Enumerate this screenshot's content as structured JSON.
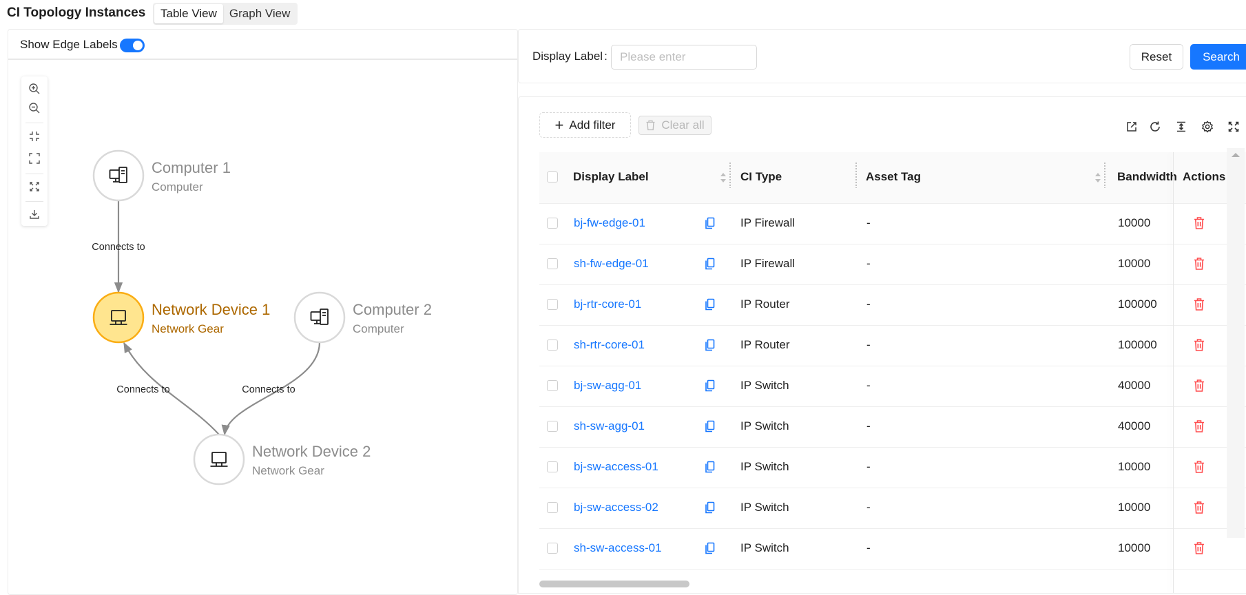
{
  "header": {
    "title": "CI Topology Instances",
    "tabs": [
      {
        "label": "Table View",
        "active": true
      },
      {
        "label": "Graph View",
        "active": false
      }
    ]
  },
  "graph_panel": {
    "edge_label_toggle": {
      "label": "Show Edge Labels",
      "on": true
    },
    "zoom_toolbar_icons": [
      "zoom-in-icon",
      "zoom-out-icon",
      "fit-view-icon",
      "fullscreen-icon",
      "reset-layout-icon",
      "download-icon"
    ],
    "nodes": [
      {
        "id": "computer-1",
        "title": "Computer 1",
        "subtitle": "Computer",
        "icon": "computer-icon",
        "selected": false
      },
      {
        "id": "network-device-1",
        "title": "Network Device 1",
        "subtitle": "Network Gear",
        "icon": "network-device-icon",
        "selected": true
      },
      {
        "id": "computer-2",
        "title": "Computer 2",
        "subtitle": "Computer",
        "icon": "computer-icon",
        "selected": false
      },
      {
        "id": "network-device-2",
        "title": "Network Device 2",
        "subtitle": "Network Gear",
        "icon": "network-device-icon",
        "selected": false
      }
    ],
    "edges": [
      {
        "from": "computer-1",
        "to": "network-device-1",
        "label": "Connects to"
      },
      {
        "from": "network-device-2",
        "to": "network-device-1",
        "label": "Connects to"
      },
      {
        "from": "computer-2",
        "to": "network-device-2",
        "label": "Connects to"
      }
    ]
  },
  "search": {
    "label": "Display Label",
    "colon": ":",
    "placeholder": "Please enter",
    "reset_label": "Reset",
    "search_label": "Search"
  },
  "table_toolbar": {
    "add_filter": "Add filter",
    "clear_all": "Clear all",
    "icons": [
      "export-icon",
      "refresh-icon",
      "density-icon",
      "settings-icon",
      "fullscreen-icon"
    ]
  },
  "table": {
    "columns": [
      "Display Label",
      "CI Type",
      "Asset Tag",
      "Bandwidth",
      "Actions"
    ],
    "rows": [
      {
        "label": "bj-fw-edge-01",
        "type": "IP Firewall",
        "asset": "-",
        "bandwidth": "10000"
      },
      {
        "label": "sh-fw-edge-01",
        "type": "IP Firewall",
        "asset": "-",
        "bandwidth": "10000"
      },
      {
        "label": "bj-rtr-core-01",
        "type": "IP Router",
        "asset": "-",
        "bandwidth": "100000"
      },
      {
        "label": "sh-rtr-core-01",
        "type": "IP Router",
        "asset": "-",
        "bandwidth": "100000"
      },
      {
        "label": "bj-sw-agg-01",
        "type": "IP Switch",
        "asset": "-",
        "bandwidth": "40000"
      },
      {
        "label": "sh-sw-agg-01",
        "type": "IP Switch",
        "asset": "-",
        "bandwidth": "40000"
      },
      {
        "label": "bj-sw-access-01",
        "type": "IP Switch",
        "asset": "-",
        "bandwidth": "10000"
      },
      {
        "label": "bj-sw-access-02",
        "type": "IP Switch",
        "asset": "-",
        "bandwidth": "10000"
      },
      {
        "label": "sh-sw-access-01",
        "type": "IP Switch",
        "asset": "-",
        "bandwidth": "10000"
      }
    ]
  },
  "colors": {
    "primary": "#1677ff",
    "danger": "#ff4d4f",
    "selected_node_fill": "#ffe58f",
    "selected_node_stroke": "#faad14",
    "selected_node_text": "#ad6800",
    "node_text": "#8c8c8c"
  }
}
